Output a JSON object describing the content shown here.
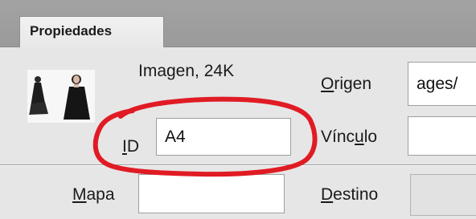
{
  "panel": {
    "tab_label": "Propiedades",
    "image_info": "Imagen, 24K"
  },
  "fields": {
    "id": {
      "label_pre": "",
      "label_ul": "I",
      "label_post": "D",
      "value": "A4"
    },
    "origen": {
      "label_pre": "",
      "label_ul": "O",
      "label_post": "rigen",
      "value": "ages/"
    },
    "vinculo": {
      "label_pre": "Vínc",
      "label_ul": "u",
      "label_post": "lo",
      "value": ""
    },
    "mapa": {
      "label_pre": "",
      "label_ul": "M",
      "label_post": "apa",
      "value": ""
    },
    "destino": {
      "label_pre": "",
      "label_ul": "D",
      "label_post": "estino",
      "value": ""
    }
  },
  "colors": {
    "annotation": "#e01b24",
    "tabstrip": "#9e9e9e",
    "panel": "#e6e6e6"
  }
}
